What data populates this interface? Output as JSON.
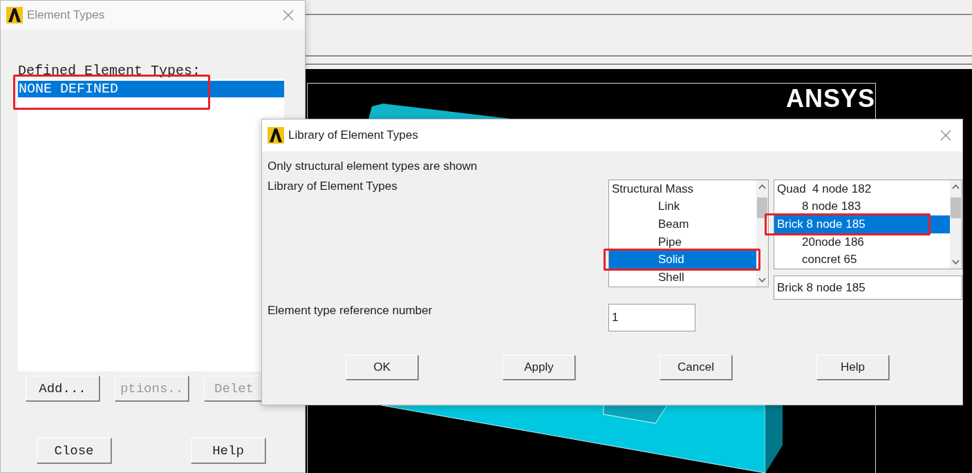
{
  "element_types_dialog": {
    "title": "Element Types",
    "label": "Defined Element Types:",
    "items": [
      {
        "text": "NONE DEFINED",
        "selected": true,
        "annotated": true
      }
    ],
    "buttons": [
      {
        "label": "Add...",
        "disabled": false
      },
      {
        "label": "ptions..",
        "disabled": true
      },
      {
        "label": "Delet",
        "disabled": true
      }
    ],
    "footer_buttons": [
      "Close",
      "Help"
    ]
  },
  "graphics": {
    "logo": "ANSYS"
  },
  "library_dialog": {
    "title": "Library of Element Types",
    "note": "Only structural element types are shown",
    "library_label": "Library of Element Types",
    "categories": [
      {
        "text": "Structural Mass",
        "kind": "heading",
        "selected": false,
        "annotated": false
      },
      {
        "text": "Link",
        "kind": "member",
        "selected": false,
        "annotated": false
      },
      {
        "text": "Beam",
        "kind": "member",
        "selected": false,
        "annotated": false
      },
      {
        "text": "Pipe",
        "kind": "member",
        "selected": false,
        "annotated": false
      },
      {
        "text": "Solid",
        "kind": "member",
        "selected": true,
        "annotated": true
      },
      {
        "text": "Shell",
        "kind": "member",
        "selected": false,
        "annotated": false
      }
    ],
    "types": [
      {
        "text": "Quad  4 node 182",
        "kind": "heading",
        "selected": false,
        "annotated": false
      },
      {
        "text": "8 node 183",
        "kind": "member",
        "selected": false,
        "annotated": false
      },
      {
        "text": "Brick 8 node 185",
        "kind": "heading",
        "selected": true,
        "annotated": true
      },
      {
        "text": "20node 186",
        "kind": "member",
        "selected": false,
        "annotated": false
      },
      {
        "text": "concret 65",
        "kind": "member",
        "selected": false,
        "annotated": false
      }
    ],
    "selection": "Brick 8 node 185",
    "ref_label": "Element type reference number",
    "ref_value": "1",
    "buttons": [
      "OK",
      "Apply",
      "Cancel",
      "Help"
    ]
  }
}
